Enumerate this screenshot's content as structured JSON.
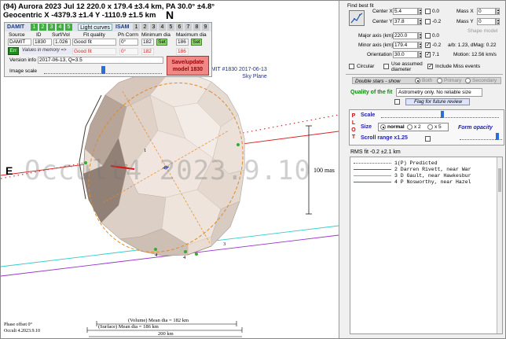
{
  "header": {
    "line1": "(94) Aurora  2023 Jul 12  220.0 x 179.4 ±3.4 km, PA 30.0° ±4.8°",
    "line2": "Geocentric  X  -4379.3 ±1.4  Y -1110.9 ±1.5 km",
    "north": "N",
    "east": "E",
    "watermark": "Occult4 2023.9.10",
    "damit_model_label_1": "DAMIT #1830 2017-06-13",
    "damit_model_label_2": "Sky Plane",
    "mas_label": "100 mas",
    "footer_1": "Phase offset 0°",
    "footer_2": "Occult 4.2023.9.10",
    "scale_volume": "(Volume) Mean dia = 182 km",
    "scale_surface": "(Surface) Mean dia = 186 km",
    "scale_200": "200 km",
    "chord_labels": [
      "1",
      "2",
      "3",
      "4",
      "4"
    ]
  },
  "damit_panel": {
    "tabs": {
      "damit": "DAMIT",
      "nums": [
        "1",
        "2",
        "3",
        "4",
        "5"
      ],
      "light_curves": "Light curves",
      "isam": "ISAM",
      "isam_nums": [
        "1",
        "2",
        "3",
        "4",
        "5",
        "6",
        "7",
        "8",
        "9"
      ]
    },
    "col_headers": {
      "source": "Source",
      "id": "ID",
      "surf_vol": "Surf/Vol",
      "fit_quality": "Fit quality",
      "ph_corrn": "Ph Corrn",
      "min_dia": "Minimum dia",
      "max_dia": "Maximum dia"
    },
    "row1": {
      "source": "DAMIT",
      "id": "1830",
      "surf_vol": "1.026",
      "fit_quality": "Good fit",
      "ph_corrn": "0°",
      "min_dia": "182",
      "max_dia": "186",
      "set_label": "Set"
    },
    "row2": {
      "fit_quality": "Good fit",
      "ph_corrn": "0°",
      "min_dia": "182",
      "max_dia": "186"
    },
    "err_label": "Err",
    "values_in_memory": "Values in memory =>",
    "version_info_label": "Version info",
    "version_info_value": "2017-06-13, Q=3.5",
    "image_scale_label": "Image scale",
    "save_button": "Save/update model 1830",
    "image_scale_value": 0.48
  },
  "right_panel": {
    "find_best_fit": "Find best fit",
    "center_x_label": "Center X",
    "center_x": "5.4",
    "center_y_label": "Center Y",
    "center_y": "37.8",
    "center_x_offset": "0.0",
    "center_y_offset": "-0.2",
    "mass_x_label": "Mass X",
    "mass_x": "0",
    "mass_y_label": "Mass Y",
    "mass_y": "0",
    "shape_model": "Shape model",
    "major_axis_label": "Major axis (km)",
    "major_axis": "220.0",
    "major_axis_offset": "0.0",
    "minor_axis_label": "Minor axis (km)",
    "minor_axis": "179.4",
    "minor_axis_offset": "-0.2",
    "orientation_label": "Orientation",
    "orientation": "30.0",
    "orientation_offset": "7.1",
    "ratio_text": "a/b: 1.23, dMag: 0.22",
    "motion_text": "Motion: 12.56 km/s",
    "circular": "Circular",
    "use_assumed": "Use assumed diameter",
    "include_miss": "Include Miss events",
    "double_stars": "Double stars - show",
    "ds_options": [
      "Both",
      "Primary",
      "Secondary"
    ],
    "quality_label": "Quality of the fit",
    "quality_value": "Astrometry only. No reliable size",
    "flag_review": "Flag for future review",
    "plot_vertical": [
      "P",
      "L",
      "O",
      "T"
    ],
    "scale_label": "Scale",
    "size_label": "Size",
    "size_options": [
      "normal",
      "x 2",
      "x 5"
    ],
    "form_opacity": "Form opacity",
    "scroll_range": "Scroll range x1.25",
    "rms_fit": "RMS fit -0.2 ±2.1 km",
    "plot_scale_value": 0.52,
    "form_opacity_value": 0.88
  },
  "legend": [
    {
      "color": "#cc3333",
      "style": "dotted",
      "text": "1(P) Predicted"
    },
    {
      "color": "#dd2222",
      "style": "solid",
      "text": "2   Darren Rivett, near War"
    },
    {
      "color": "#33cccc",
      "style": "solid",
      "text": "3   D Gault, near Hawkesbur"
    },
    {
      "color": "#9933cc",
      "style": "solid",
      "text": "4   P Nosworthy, near Hazel"
    }
  ]
}
